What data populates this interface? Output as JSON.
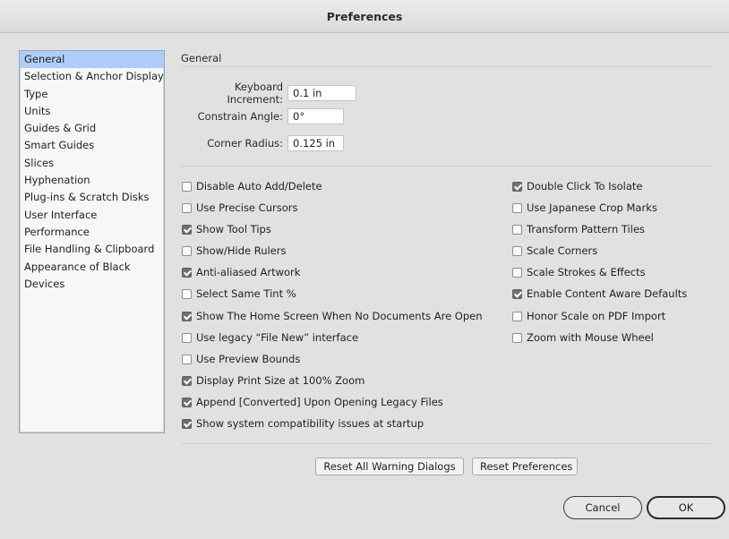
{
  "window": {
    "title": "Preferences"
  },
  "sidebar": {
    "items": [
      {
        "label": "General",
        "selected": true
      },
      {
        "label": "Selection & Anchor Display"
      },
      {
        "label": "Type"
      },
      {
        "label": "Units"
      },
      {
        "label": "Guides & Grid"
      },
      {
        "label": "Smart Guides"
      },
      {
        "label": "Slices"
      },
      {
        "label": "Hyphenation"
      },
      {
        "label": "Plug-ins & Scratch Disks"
      },
      {
        "label": "User Interface"
      },
      {
        "label": "Performance"
      },
      {
        "label": "File Handling & Clipboard"
      },
      {
        "label": "Appearance of Black"
      },
      {
        "label": "Devices"
      }
    ]
  },
  "general": {
    "title": "General",
    "keyboard_increment": {
      "label": "Keyboard Increment:",
      "value": "0.1 in"
    },
    "constrain_angle": {
      "label": "Constrain Angle:",
      "value": "0°"
    },
    "corner_radius": {
      "label": "Corner Radius:",
      "value": "0.125 in"
    }
  },
  "options_left": [
    {
      "label": "Disable Auto Add/Delete",
      "checked": false
    },
    {
      "label": "Use Precise Cursors",
      "checked": false
    },
    {
      "label": "Show Tool Tips",
      "checked": true
    },
    {
      "label": "Show/Hide Rulers",
      "checked": false
    },
    {
      "label": "Anti-aliased Artwork",
      "checked": true
    },
    {
      "label": "Select Same Tint %",
      "checked": false
    },
    {
      "label": "Show The Home Screen When No Documents Are Open",
      "checked": true
    },
    {
      "label": "Use legacy “File New” interface",
      "checked": false
    },
    {
      "label": "Use Preview Bounds",
      "checked": false
    },
    {
      "label": "Display Print Size at 100% Zoom",
      "checked": true
    },
    {
      "label": "Append [Converted] Upon Opening Legacy Files",
      "checked": true
    },
    {
      "label": "Show system compatibility issues at startup",
      "checked": true
    }
  ],
  "options_right": [
    {
      "label": "Double Click To Isolate",
      "checked": true
    },
    {
      "label": "Use Japanese Crop Marks",
      "checked": false
    },
    {
      "label": "Transform Pattern Tiles",
      "checked": false
    },
    {
      "label": "Scale Corners",
      "checked": false
    },
    {
      "label": "Scale Strokes & Effects",
      "checked": false
    },
    {
      "label": "Enable Content Aware Defaults",
      "checked": true
    },
    {
      "label": "Honor Scale on PDF Import",
      "checked": false
    },
    {
      "label": "Zoom with Mouse Wheel",
      "checked": false
    }
  ],
  "buttons": {
    "reset_warnings": "Reset All Warning Dialogs",
    "reset_prefs": "Reset Preferences",
    "cancel": "Cancel",
    "ok": "OK"
  }
}
